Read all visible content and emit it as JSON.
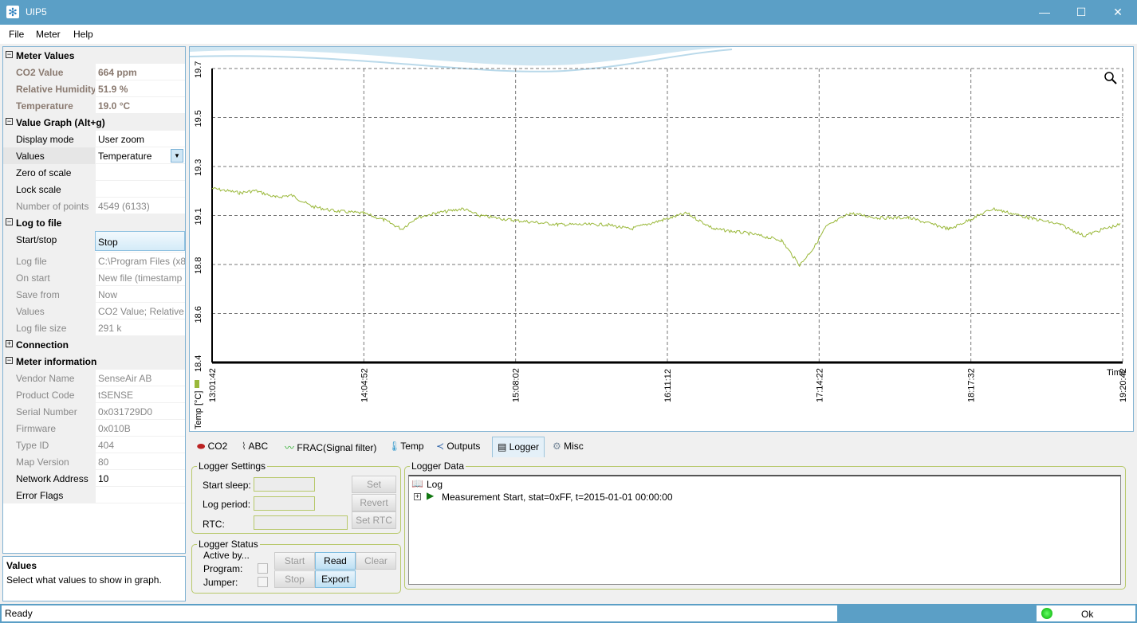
{
  "window": {
    "title": "UIP5",
    "minimize": "—",
    "maximize": "☐",
    "close": "✕"
  },
  "menu": [
    "File",
    "Meter",
    "Help"
  ],
  "props": {
    "groups": {
      "meter_values": "Meter Values",
      "value_graph": "Value Graph (Alt+g)",
      "log_to_file": "Log to file",
      "connection": "Connection",
      "meter_info": "Meter information"
    },
    "meter_values": [
      [
        "CO2 Value",
        "664 ppm"
      ],
      [
        "Relative Humidity",
        "51.9 %"
      ],
      [
        "Temperature",
        "19.0 °C"
      ]
    ],
    "value_graph": [
      [
        "Display mode",
        "User zoom"
      ],
      [
        "Values",
        "Temperature"
      ],
      [
        "Zero of scale",
        ""
      ],
      [
        "Lock scale",
        ""
      ],
      [
        "Number of points",
        "4549 (6133)"
      ]
    ],
    "log_to_file": [
      [
        "Start/stop",
        "Stop"
      ],
      [
        "Log file",
        "C:\\Program Files (x86"
      ],
      [
        "On start",
        "New file (timestamp"
      ],
      [
        "Save from",
        "Now"
      ],
      [
        "Values",
        "CO2 Value; Relative H"
      ],
      [
        "Log file size",
        "291 k"
      ]
    ],
    "meter_info": [
      [
        "Vendor Name",
        "SenseAir AB"
      ],
      [
        "Product Code",
        "tSENSE"
      ],
      [
        "Serial Number",
        "0x031729D0"
      ],
      [
        "Firmware",
        "0x010B"
      ],
      [
        "Type ID",
        "404"
      ],
      [
        "Map Version",
        "80"
      ],
      [
        "Network Address",
        "10"
      ],
      [
        "Error Flags",
        ""
      ]
    ]
  },
  "help": {
    "title": "Values",
    "text": "Select what values to show in graph."
  },
  "chart_data": {
    "type": "line",
    "ylabel": "Temp [°C]",
    "xlabel": "Time",
    "ylim": [
      18.4,
      19.7
    ],
    "ytick_labels": [
      "18.4",
      "18.6",
      "18.8",
      "19.1",
      "19.3",
      "19.5",
      "19.7"
    ],
    "xtick_labels": [
      "13:01:42",
      "14:04:52",
      "15:08:02",
      "16:11:12",
      "17:14:22",
      "18:17:32",
      "19:20:42"
    ],
    "x_unit": "minutes since 13:01:42",
    "xlim": [
      0,
      379
    ],
    "color": "#9ab83a",
    "series": [
      {
        "name": "Temperature",
        "x": [
          0,
          11.6,
          18,
          26.5,
          33,
          41.5,
          51,
          63,
          71.7,
          79,
          85,
          93,
          104.5,
          111,
          124.5,
          144,
          164,
          174,
          187.5,
          197.5,
          209,
          224,
          237,
          244.6,
          250.6,
          255.5,
          265.5,
          277,
          290,
          307,
          317,
          325,
          340,
          353,
          363,
          371,
          378
        ],
        "y": [
          19.17,
          19.15,
          19.16,
          19.13,
          19.14,
          19.09,
          19.07,
          19.06,
          19.03,
          18.99,
          19.04,
          19.06,
          19.08,
          19.05,
          19.03,
          19.01,
          19.01,
          18.99,
          19.03,
          19.06,
          18.99,
          18.97,
          18.94,
          18.83,
          18.91,
          19.0,
          19.06,
          19.04,
          19.04,
          18.99,
          19.04,
          19.08,
          19.04,
          19.01,
          18.96,
          18.99,
          19.01
        ]
      }
    ]
  },
  "tabs": [
    "CO2",
    "ABC",
    "FRAC(Signal filter)",
    "Temp",
    "Outputs",
    "Logger",
    "Misc"
  ],
  "logger": {
    "settings_title": "Logger Settings",
    "start_sleep": "Start sleep:",
    "log_period": "Log period:",
    "rtc": "RTC:",
    "set": "Set",
    "revert": "Revert",
    "set_rtc": "Set RTC",
    "status_title": "Logger Status",
    "active_by": "Active by...",
    "program": "Program:",
    "jumper": "Jumper:",
    "start": "Start",
    "read": "Read",
    "clear": "Clear",
    "stop": "Stop",
    "export": "Export",
    "data_title": "Logger Data",
    "tree_root": "Log",
    "tree_item": "Measurement Start, stat=0xFF, t=2015-01-01 00:00:00"
  },
  "status": {
    "text": "Ready",
    "ok": "Ok"
  }
}
